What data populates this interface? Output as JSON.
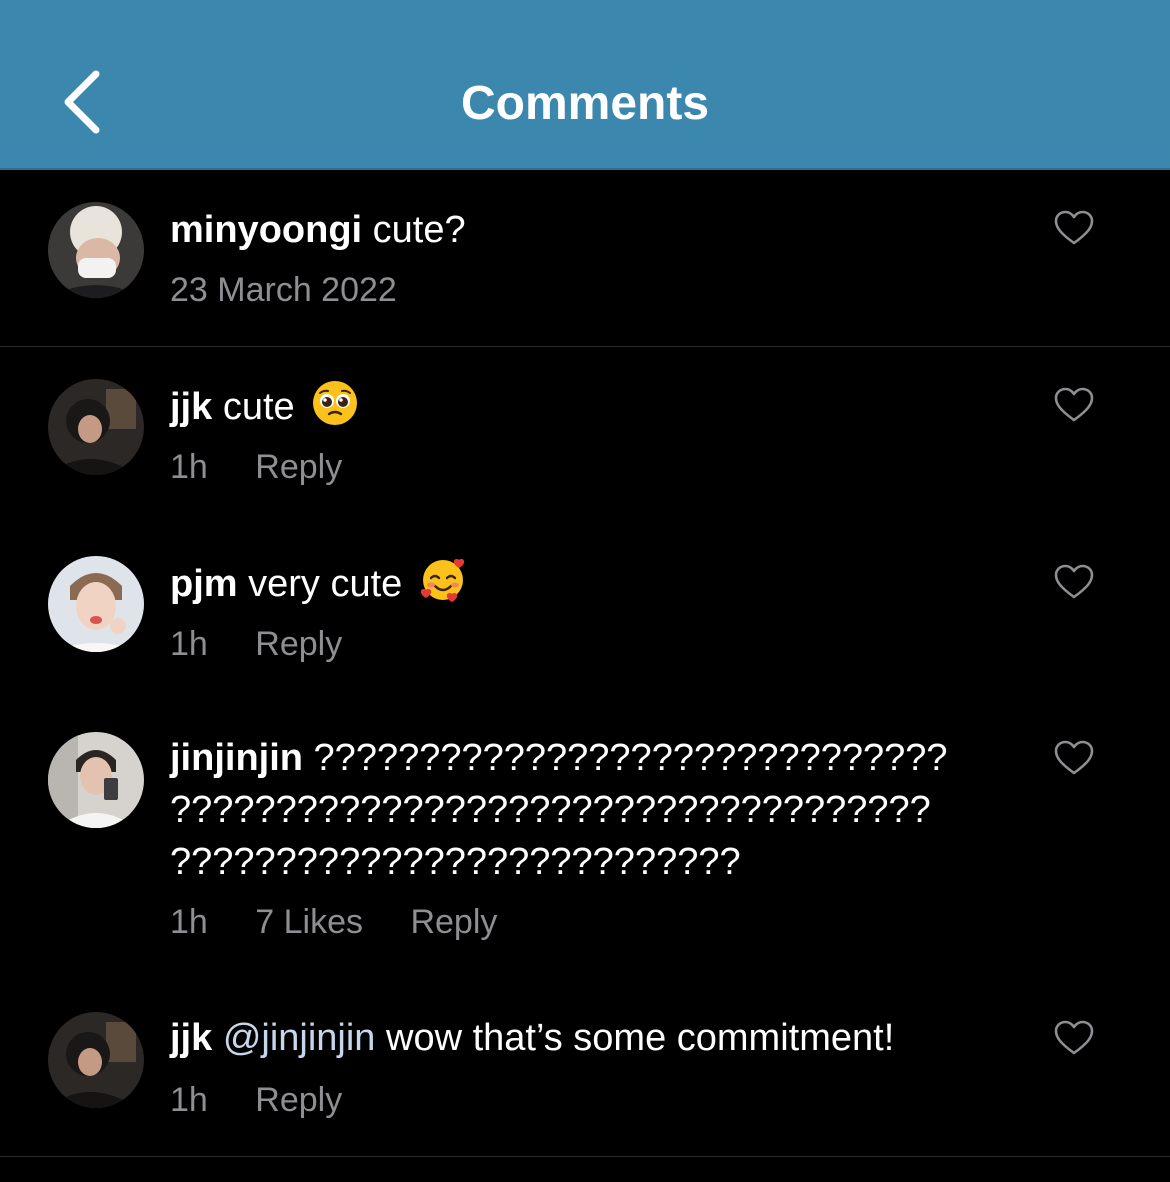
{
  "header": {
    "title": "Comments",
    "back_icon": "chevron-left-icon",
    "background": "#3b87ad"
  },
  "caption": {
    "username": "minyoongi",
    "text": "cute?",
    "date": "23 March 2022"
  },
  "comments": [
    {
      "username": "jjk",
      "text": "cute",
      "emoji": "pleading-face-emoji",
      "time": "1h",
      "reply": "Reply"
    },
    {
      "username": "pjm",
      "text": "very cute",
      "emoji": "smiling-face-with-hearts-emoji",
      "time": "1h",
      "reply": "Reply"
    },
    {
      "username": "jinjinjin",
      "text_lines": [
        "??????????????????????????????",
        "????????????????????????????????????",
        "???????????????????????????"
      ],
      "time": "1h",
      "likes": "7 Likes",
      "reply": "Reply"
    },
    {
      "username": "jjk",
      "mention": "@jinjinjin",
      "text": "wow that’s some commitment!",
      "time": "1h",
      "reply": "Reply"
    }
  ],
  "colors": {
    "background": "#000000",
    "meta_text": "#8e8e93",
    "mention": "#c7d6ea",
    "divider": "#2a2a2c"
  }
}
